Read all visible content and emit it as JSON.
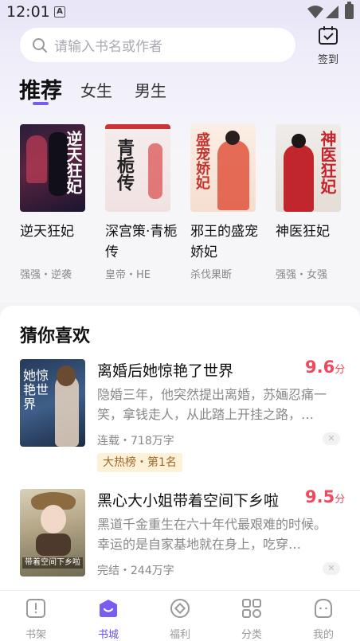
{
  "status": {
    "time": "12:01",
    "notif_letter": "A"
  },
  "search": {
    "placeholder": "请输入书名或作者"
  },
  "checkin": {
    "label": "签到"
  },
  "tabs": [
    {
      "label": "推荐",
      "active": true
    },
    {
      "label": "女生",
      "active": false
    },
    {
      "label": "男生",
      "active": false
    }
  ],
  "recommended": [
    {
      "title": "逆天狂妃",
      "tags": "强强・逆袭",
      "cover_text": "逆天狂妃"
    },
    {
      "title": "深宫策·青栀传",
      "tags": "皇帝・HE",
      "cover_text": "青栀传"
    },
    {
      "title": "邪王的盛宠娇妃",
      "tags": "杀伐果断",
      "cover_text": "盛宠娇妃"
    },
    {
      "title": "神医狂妃",
      "tags": "强强・女强",
      "cover_text": "神医狂妃"
    }
  ],
  "guess": {
    "title": "猜你喜欢",
    "items": [
      {
        "title": "离婚后她惊艳了世界",
        "score": "9.6",
        "score_unit": "分",
        "desc": "隐婚三年，他突然提出离婚，苏婳忍痛一笑，拿钱走人，从此踏上开挂之路，…",
        "meta": "连载・718万字",
        "badge": "大热榜・第1名",
        "cover_text": "她惊艳世界"
      },
      {
        "title": "黑心大小姐带着空间下乡啦",
        "score": "9.5",
        "score_unit": "分",
        "desc": "黑道千金重生在六十年代最艰难的时候。幸运的是自家基地就在身上，吃穿…",
        "meta": "完结・244万字",
        "badge": "",
        "cover_text": "带着空间下乡啦"
      }
    ]
  },
  "nav": [
    {
      "label": "书架",
      "icon": "bookshelf-icon",
      "active": false
    },
    {
      "label": "书城",
      "icon": "bookstore-icon",
      "active": true
    },
    {
      "label": "福利",
      "icon": "welfare-icon",
      "active": false
    },
    {
      "label": "分类",
      "icon": "category-icon",
      "active": false
    },
    {
      "label": "我的",
      "icon": "profile-icon",
      "active": false
    }
  ],
  "colors": {
    "accent": "#6b4ef0",
    "score": "#f0485c",
    "badge_bg": "#fdf1d8"
  }
}
